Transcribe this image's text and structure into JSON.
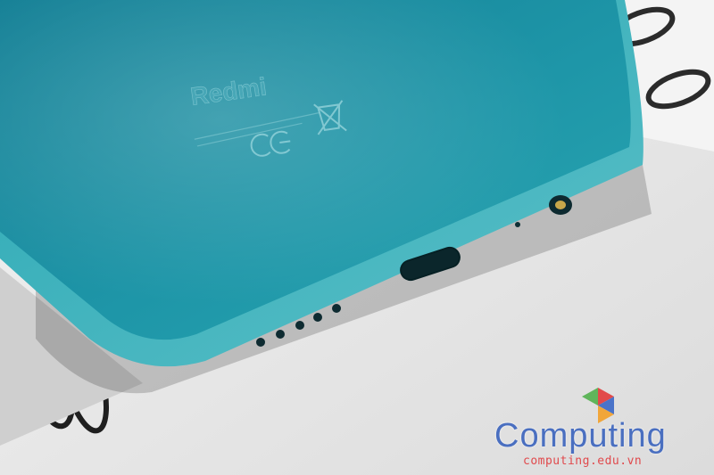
{
  "photo": {
    "subject": "phone-bottom-edge",
    "colors": {
      "background": "#e9e9e9",
      "phone_body": "#1e93a6",
      "phone_edge": "#4fb6c2"
    }
  },
  "phone_branding": {
    "logo_text": "Redmi"
  },
  "watermark": {
    "brand": "Computing",
    "url": "computing.edu.vn",
    "colors": {
      "brand": "#4a6fc0",
      "url": "#e0494c"
    }
  }
}
